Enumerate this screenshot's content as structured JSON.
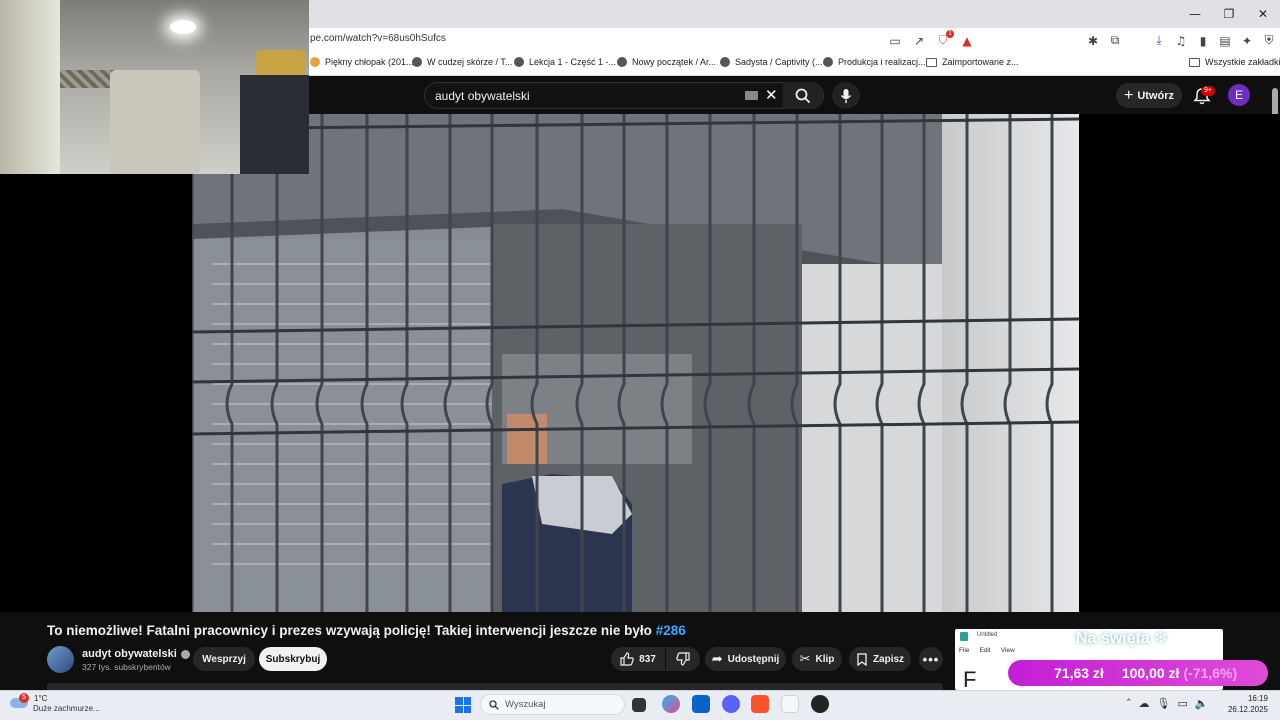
{
  "browser": {
    "url": "pe.com/watch?v=68us0hSufcs",
    "window_controls": [
      "—",
      "❐",
      "✕"
    ],
    "bookmarks": [
      {
        "label": "Piękny chłopak (201...",
        "icon": "site-icon"
      },
      {
        "label": "W cudzej skórze / T...",
        "icon": "globe-icon"
      },
      {
        "label": "Lekcja 1 - Część 1 -...",
        "icon": "globe-icon"
      },
      {
        "label": "Nowy początek / Ar...",
        "icon": "globe-icon"
      },
      {
        "label": "Sadysta / Captivity (...",
        "icon": "globe-icon"
      },
      {
        "label": "Produkcja i realizacj...",
        "icon": "globe-icon"
      },
      {
        "label": "Zaimportowane z...",
        "icon": "folder-icon"
      }
    ],
    "all_bookmarks": "Wszystkie zakładki",
    "extension_badge": "1"
  },
  "youtube": {
    "search": {
      "query": "audyt obywatelski"
    },
    "create_label": "Utwórz",
    "notifications_badge": "9+",
    "avatar_letter": "E",
    "video": {
      "title": "To niemożliwe! Fatalni pracownicy i prezes wzywają policję! Takiej interwencji jeszcze nie było",
      "hashtag": "#286"
    },
    "channel": {
      "name": "audyt obywatelski",
      "subscribers": "327 tys. subskrybentów",
      "support_label": "Wesprzyj",
      "subscribe_label": "Subskrybuj"
    },
    "actions": {
      "likes": "837",
      "share": "Udostępnij",
      "clip": "Klip",
      "save": "Zapisz"
    }
  },
  "ad": {
    "window_title": "Untitled",
    "menu": [
      "File",
      "Edit",
      "View"
    ],
    "holiday": "Na święta ❄",
    "price_new": "71,63 zł",
    "price_old": "100,00 zł",
    "discount": "(-71,6%)"
  },
  "taskbar": {
    "weather": {
      "temp": "1°C",
      "desc": "Duże zachmurze...",
      "badge": "5"
    },
    "search_placeholder": "Wyszukaj",
    "time": "16:19",
    "date": "26.12.2025"
  }
}
